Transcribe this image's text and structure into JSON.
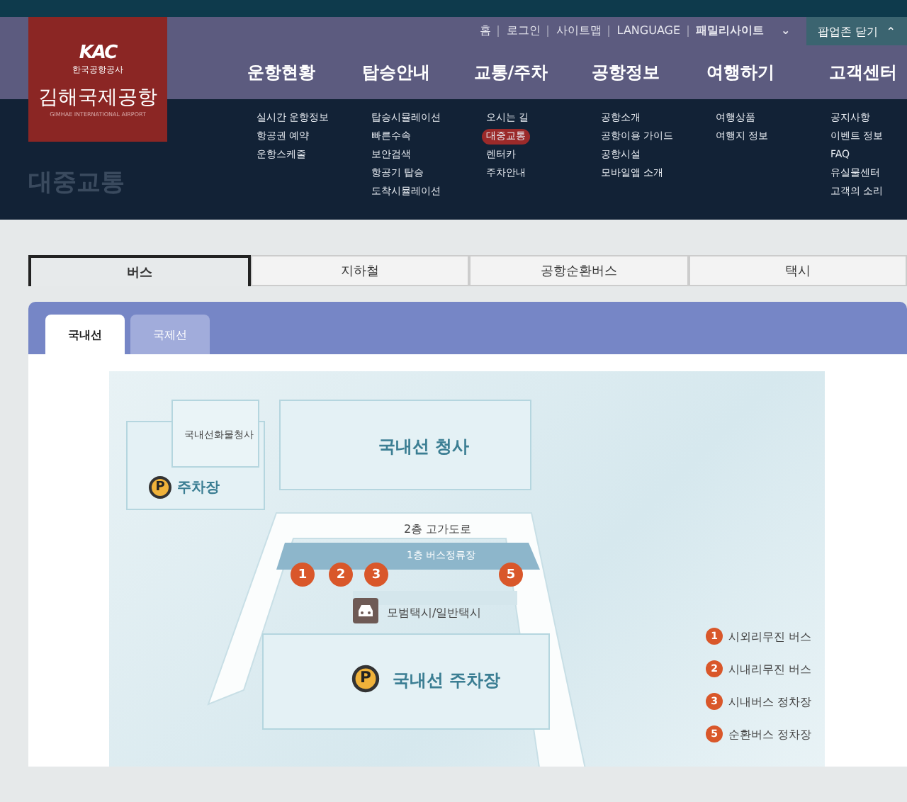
{
  "top_links": [
    {
      "label": "홈"
    },
    {
      "label": "로그인"
    },
    {
      "label": "사이트맵"
    },
    {
      "label": "LANGUAGE"
    },
    {
      "label": "패밀리사이트",
      "caret": "⌄"
    }
  ],
  "popup_button": {
    "label": "팝업존 닫기",
    "caret": "⌃"
  },
  "logo": {
    "mark": "KAC",
    "org": "한국공항공사",
    "name": "김해국제공항",
    "subtitle": "GIMHAE INTERNATIONAL AIRPORT"
  },
  "nav": [
    {
      "label": "운항현황",
      "items": [
        {
          "label": "실시간 운항정보",
          "selected": false
        },
        {
          "label": "항공권 예약",
          "selected": false
        },
        {
          "label": "운항스케줄",
          "selected": false
        }
      ]
    },
    {
      "label": "탑승안내",
      "items": [
        {
          "label": "탑승시뮬레이션",
          "selected": false
        },
        {
          "label": "빠른수속",
          "selected": false
        },
        {
          "label": "보안검색",
          "selected": false
        },
        {
          "label": "항공기 탑승",
          "selected": false
        },
        {
          "label": "도착시뮬레이션",
          "selected": false
        }
      ]
    },
    {
      "label": "교통/주차",
      "items": [
        {
          "label": "오시는 길",
          "selected": false
        },
        {
          "label": "대중교통",
          "selected": true
        },
        {
          "label": "렌터카",
          "selected": false
        },
        {
          "label": "주차안내",
          "selected": false
        }
      ]
    },
    {
      "label": "공항정보",
      "items": [
        {
          "label": "공항소개",
          "selected": false
        },
        {
          "label": "공항이용 가이드",
          "selected": false
        },
        {
          "label": "공항시설",
          "selected": false
        },
        {
          "label": "모바일앱 소개",
          "selected": false
        }
      ]
    },
    {
      "label": "여행하기",
      "items": [
        {
          "label": "여행상품",
          "selected": false
        },
        {
          "label": "여행지 정보",
          "selected": false
        }
      ]
    },
    {
      "label": "고객센터",
      "items": [
        {
          "label": "공지사항",
          "selected": false
        },
        {
          "label": "이벤트 정보",
          "selected": false
        },
        {
          "label": "FAQ",
          "selected": false
        },
        {
          "label": "유실물센터",
          "selected": false
        },
        {
          "label": "고객의 소리",
          "selected": false
        }
      ]
    }
  ],
  "page_title": "대중교통",
  "tabs": [
    {
      "label": "버스",
      "selected": true
    },
    {
      "label": "지하철",
      "selected": false
    },
    {
      "label": "공항순환버스",
      "selected": false
    },
    {
      "label": "택시",
      "selected": false
    }
  ],
  "sub_tabs": [
    {
      "label": "국내선",
      "selected": true
    },
    {
      "label": "국제선",
      "selected": false
    }
  ],
  "map": {
    "cargo_terminal": "국내선화물청사",
    "parking_lot": "주차장",
    "parking_mark": "P",
    "terminal": "국내선 청사",
    "overpass": "2층 고가도로",
    "bus_stop_area": "1층 버스정류장",
    "taxi": "모범택시/일반택시",
    "domestic_parking": "국내선 주차장",
    "domestic_parking_mark": "P",
    "stops": [
      {
        "number": "1"
      },
      {
        "number": "2"
      },
      {
        "number": "3"
      },
      {
        "number": "5"
      }
    ],
    "legend": [
      {
        "number": "1",
        "label": "시외리무진 버스"
      },
      {
        "number": "2",
        "label": "시내리무진 버스"
      },
      {
        "number": "3",
        "label": "시내버스 정차장"
      },
      {
        "number": "5",
        "label": "순환버스 정차장"
      }
    ]
  }
}
